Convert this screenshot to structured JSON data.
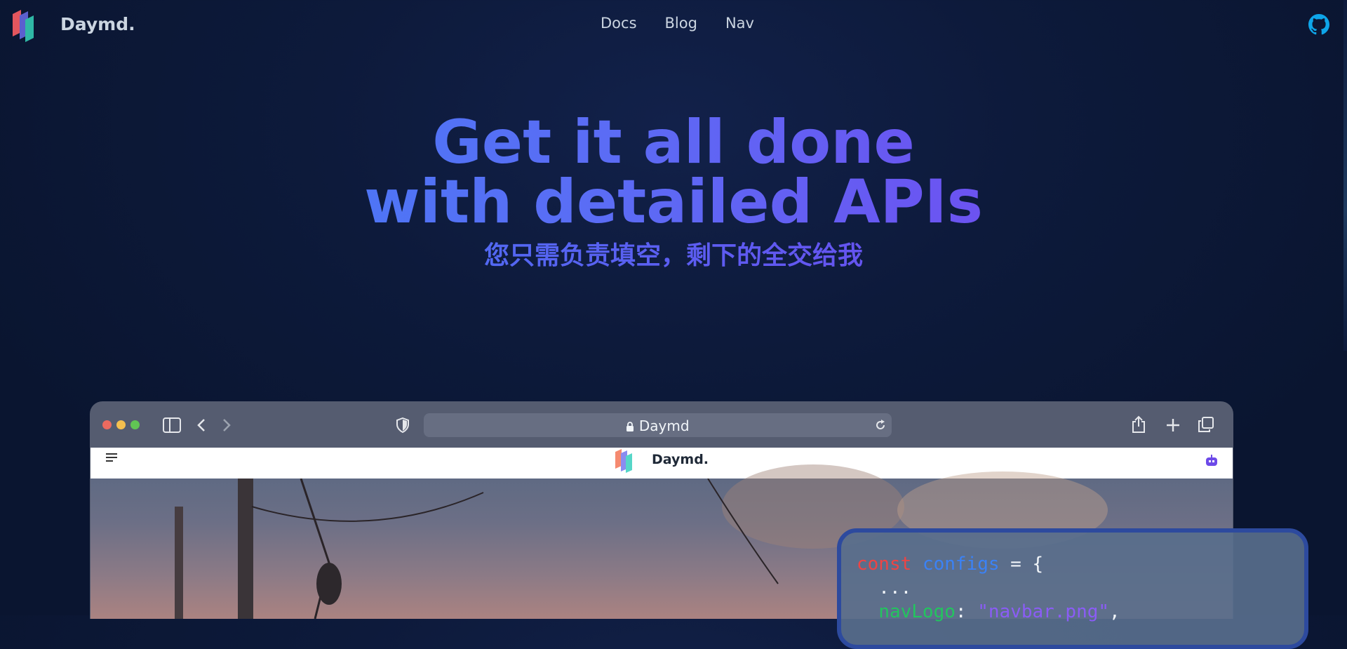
{
  "header": {
    "brand": "Daymd.",
    "nav_items": [
      "Docs",
      "Blog",
      "Nav"
    ],
    "github_icon": "github-icon"
  },
  "hero": {
    "title_line1": "Get it all done",
    "title_line2": "with detailed APIs",
    "subtitle": "您只需负责填空，剩下的全交给我"
  },
  "browser": {
    "url": "Daymd",
    "inner_brand": "Daymd."
  },
  "code": {
    "line1_kw": "const",
    "line1_var": "configs",
    "line1_rest": " = {",
    "line2": "  ...",
    "line3_prop": "navLogo",
    "line3_sep": ": ",
    "line3_str": "\"navbar.png\"",
    "line3_end": ","
  },
  "colors": {
    "background": "#0d1a3b",
    "gradient_start": "#3b82f6",
    "gradient_end": "#7c3aed",
    "github": "#0ea5e9"
  }
}
